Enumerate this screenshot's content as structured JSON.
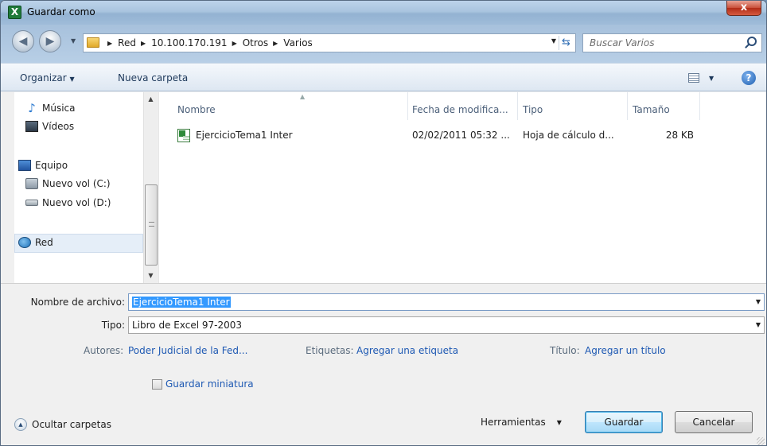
{
  "window": {
    "title": "Guardar como",
    "close_label": "x"
  },
  "address": {
    "crumbs": [
      "Red",
      "10.100.170.191",
      "Otros",
      "Varios"
    ],
    "search_placeholder": "Buscar Varios"
  },
  "toolbar": {
    "organize_label": "Organizar",
    "new_folder_label": "Nueva carpeta"
  },
  "nav": {
    "items": [
      {
        "label": "Música",
        "icon": "music-icon"
      },
      {
        "label": "Vídeos",
        "icon": "video-icon"
      },
      {
        "label": "Equipo",
        "icon": "computer-icon"
      },
      {
        "label": "Nuevo vol (C:)",
        "icon": "drive-icon"
      },
      {
        "label": "Nuevo vol (D:)",
        "icon": "drive-icon"
      },
      {
        "label": "Red",
        "icon": "network-icon"
      }
    ]
  },
  "files": {
    "columns": [
      "Nombre",
      "Fecha de modifica...",
      "Tipo",
      "Tamaño"
    ],
    "rows": [
      {
        "name": "EjercicioTema1 Inter",
        "date": "02/02/2011 05:32 ...",
        "type": "Hoja de cálculo d...",
        "size": "28 KB"
      }
    ]
  },
  "form": {
    "filename_label": "Nombre de archivo:",
    "filename_value": "EjercicioTema1 Inter",
    "type_label": "Tipo:",
    "type_value": "Libro de Excel 97-2003",
    "authors_label": "Autores:",
    "authors_value": "Poder Judicial de la Fed...",
    "tags_label": "Etiquetas:",
    "tags_value": "Agregar una etiqueta",
    "title_label": "Título:",
    "title_value": "Agregar un título",
    "thumbnail_label": "Guardar miniatura"
  },
  "footer": {
    "hide_folders_label": "Ocultar carpetas",
    "tools_label": "Herramientas",
    "save_label": "Guardar",
    "cancel_label": "Cancelar"
  }
}
